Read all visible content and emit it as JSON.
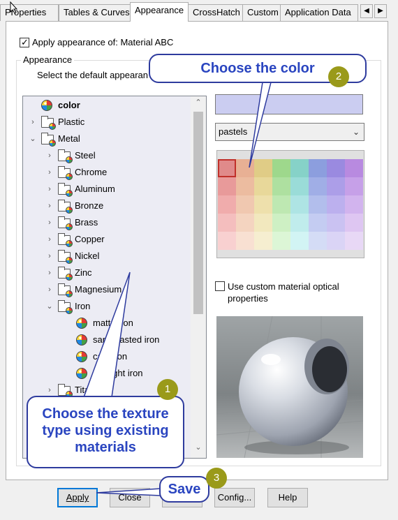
{
  "tabs": [
    "Properties",
    "Tables & Curves",
    "Appearance",
    "CrossHatch",
    "Custom",
    "Application Data"
  ],
  "tab_scroll": {
    "left": "◀",
    "right": "▶"
  },
  "apply_checkbox_label": "Apply appearance of: Material ABC",
  "group_label": "Appearance",
  "instruction": "Select the default appearan",
  "tree": [
    {
      "label": "color",
      "level": 0,
      "icon": "color-ball-icon",
      "expander": "",
      "bold": true
    },
    {
      "label": "Plastic",
      "level": 0,
      "icon": "appearance-folder-icon",
      "expander": "›"
    },
    {
      "label": "Metal",
      "level": 0,
      "icon": "appearance-folder-icon",
      "expander": "⌄"
    },
    {
      "label": "Steel",
      "level": 1,
      "icon": "appearance-folder-icon",
      "expander": "›"
    },
    {
      "label": "Chrome",
      "level": 1,
      "icon": "appearance-folder-icon",
      "expander": "›"
    },
    {
      "label": "Aluminum",
      "level": 1,
      "icon": "appearance-folder-icon",
      "expander": "›"
    },
    {
      "label": "Bronze",
      "level": 1,
      "icon": "appearance-folder-icon",
      "expander": "›"
    },
    {
      "label": "Brass",
      "level": 1,
      "icon": "appearance-folder-icon",
      "expander": "›"
    },
    {
      "label": "Copper",
      "level": 1,
      "icon": "appearance-folder-icon",
      "expander": "›"
    },
    {
      "label": "Nickel",
      "level": 1,
      "icon": "appearance-folder-icon",
      "expander": "›"
    },
    {
      "label": "Zinc",
      "level": 1,
      "icon": "appearance-folder-icon",
      "expander": "›"
    },
    {
      "label": "Magnesium",
      "level": 1,
      "icon": "appearance-folder-icon",
      "expander": "›"
    },
    {
      "label": "Iron",
      "level": 1,
      "icon": "appearance-folder-icon",
      "expander": "⌄"
    },
    {
      "label": "matte iron",
      "level": 2,
      "icon": "color-ball-icon",
      "expander": ""
    },
    {
      "label": "sandblasted iron",
      "level": 2,
      "icon": "color-ball-icon",
      "expander": ""
    },
    {
      "label": "cast iron",
      "level": 2,
      "icon": "color-ball-icon",
      "expander": ""
    },
    {
      "label": "wrought iron",
      "level": 2,
      "icon": "color-ball-icon",
      "expander": ""
    },
    {
      "label": "Titanium",
      "level": 1,
      "icon": "appearance-folder-icon",
      "expander": "›"
    }
  ],
  "scroll_arrows": {
    "up": "⌃",
    "down": "⌄"
  },
  "palette_select": {
    "value": "pastels",
    "arrow": "⌄"
  },
  "selected_color": "#cbcdf1",
  "palette_colors": [
    [
      "#e08a8a",
      "#e8b094",
      "#e0cc86",
      "#9ed88c",
      "#86d2c8",
      "#8c9ede",
      "#9a8ae0",
      "#b88ae0"
    ],
    [
      "#e89a9a",
      "#ecbca0",
      "#e8d89a",
      "#aee0a0",
      "#9adcd8",
      "#a0aee6",
      "#ac9ee8",
      "#c6a0e8"
    ],
    [
      "#f0acac",
      "#f0c8b0",
      "#eee0ac",
      "#bee8b2",
      "#aee4e4",
      "#b2beec",
      "#bcb0ee",
      "#d2b4ee"
    ],
    [
      "#f4bebe",
      "#f4d4c0",
      "#f2e8be",
      "#cef0c4",
      "#c0ecec",
      "#c4ccf2",
      "#cac2f2",
      "#dec6f2"
    ],
    [
      "#f8d0d0",
      "#f8e0d2",
      "#f6eed0",
      "#dcf6d6",
      "#d2f4f4",
      "#d4dcf6",
      "#dad4f6",
      "#e8d8f6"
    ]
  ],
  "custom_optical_label": "Use custom material optical properties",
  "buttons": {
    "apply": "Apply",
    "close": "Close",
    "config": "Config...",
    "help": "Help"
  },
  "callouts": {
    "choose_color": "Choose the color",
    "choose_texture": "Choose the texture type using existing materials",
    "save": "Save"
  },
  "badges": [
    "1",
    "2",
    "3"
  ]
}
